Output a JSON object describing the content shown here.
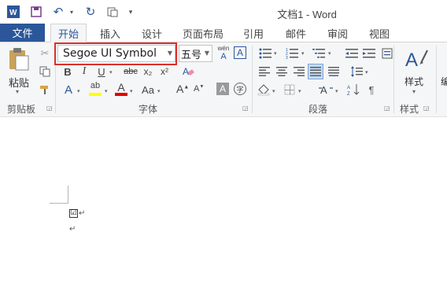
{
  "window": {
    "title": "文档1 - Word"
  },
  "qat": {
    "undo_icon": "undo-icon",
    "redo_icon": "redo-icon"
  },
  "tabs": [
    "文件",
    "开始",
    "插入",
    "设计",
    "页面布局",
    "引用",
    "邮件",
    "审阅",
    "视图"
  ],
  "clipboard": {
    "paste_label": "粘贴",
    "group_label": "剪贴板"
  },
  "font": {
    "name": "Segoe UI Symbol",
    "size": "五号",
    "group_label": "字体",
    "phonetic_glyph": "wén",
    "border_glyph": "A",
    "bold": "B",
    "italic": "I",
    "underline": "U",
    "strike": "abc",
    "sub": "x₂",
    "sup": "x²",
    "effects": "A",
    "highlight": "ab",
    "color": "A",
    "case": "Aa",
    "grow": "A",
    "shrink": "A",
    "shade": "A",
    "enclose": "字"
  },
  "paragraph": {
    "group_label": "段落"
  },
  "styles": {
    "label": "样式",
    "group_label": "样式",
    "edit_label": "编"
  },
  "document": {
    "checkbox_glyph": "☑",
    "para_mark": "↵"
  },
  "colors": {
    "accent": "#2b579a",
    "highlight_border": "#d9302b",
    "highlight_yellow": "#ffff00",
    "font_red": "#e00000"
  }
}
